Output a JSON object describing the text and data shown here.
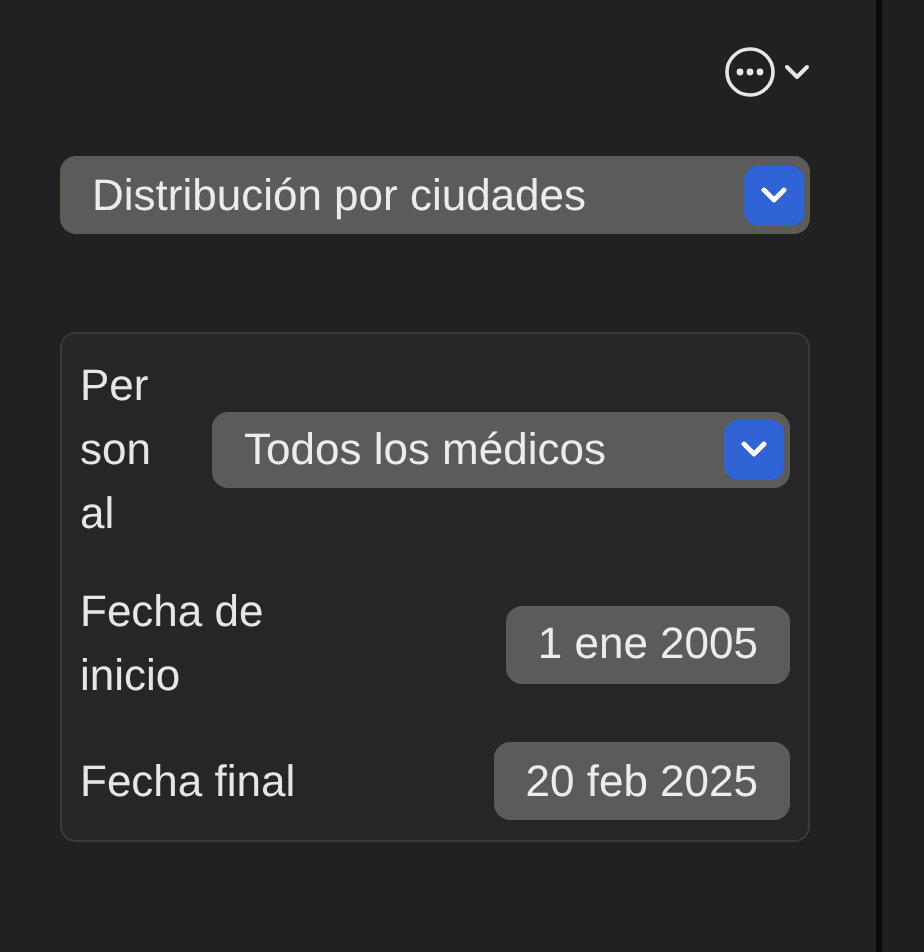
{
  "view_popup": {
    "value": "Distribución por ciudades"
  },
  "filters": [
    {
      "kind": "popup",
      "label": "Personal",
      "value": "Todos los médicos"
    },
    {
      "kind": "date",
      "label": "Fecha de inicio",
      "value": "1 ene 2005"
    },
    {
      "kind": "date",
      "label": "Fecha final",
      "value": "20 feb 2025"
    }
  ]
}
